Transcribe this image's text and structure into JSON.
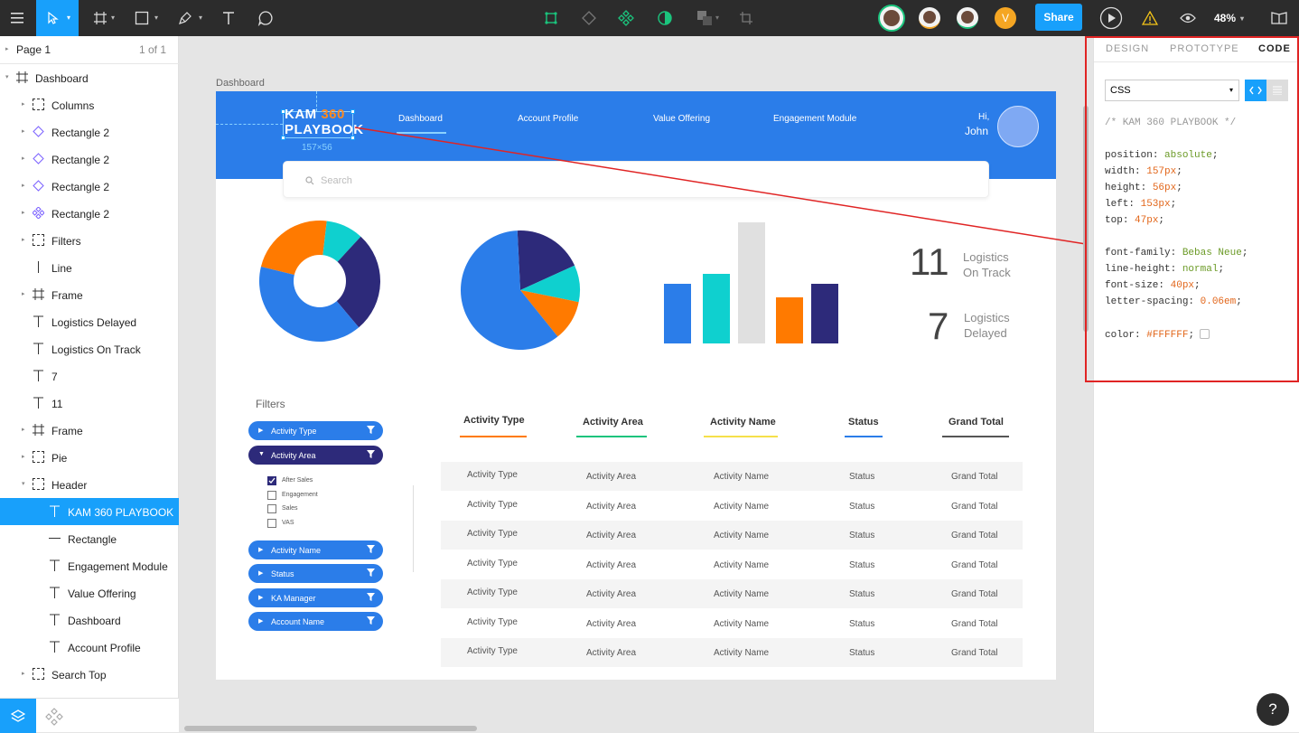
{
  "toolbar": {
    "share_label": "Share",
    "zoom": "48%",
    "avatar_initial": "V"
  },
  "sidebar": {
    "page_name": "Page 1",
    "page_count": "1 of 1",
    "layers": [
      {
        "label": "Dashboard",
        "icon": "frame"
      },
      {
        "label": "Columns",
        "icon": "group"
      },
      {
        "label": "Rectangle 2",
        "icon": "diamond"
      },
      {
        "label": "Rectangle 2",
        "icon": "diamond"
      },
      {
        "label": "Rectangle 2",
        "icon": "diamond"
      },
      {
        "label": "Rectangle 2",
        "icon": "component"
      },
      {
        "label": "Filters",
        "icon": "group"
      },
      {
        "label": "Line",
        "icon": "line"
      },
      {
        "label": "Frame",
        "icon": "frame"
      },
      {
        "label": "Logistics Delayed",
        "icon": "text"
      },
      {
        "label": "Logistics On Track",
        "icon": "text"
      },
      {
        "label": "7",
        "icon": "text"
      },
      {
        "label": "11",
        "icon": "text"
      },
      {
        "label": "Frame",
        "icon": "frame"
      },
      {
        "label": "Pie",
        "icon": "group"
      },
      {
        "label": "Header",
        "icon": "group"
      },
      {
        "label": "KAM 360 PLAYBOOK",
        "icon": "text"
      },
      {
        "label": "Rectangle",
        "icon": "line"
      },
      {
        "label": "Engagement Module",
        "icon": "text"
      },
      {
        "label": "Value Offering",
        "icon": "text"
      },
      {
        "label": "Dashboard",
        "icon": "text"
      },
      {
        "label": "Account Profile",
        "icon": "text"
      },
      {
        "label": "Search Top",
        "icon": "group"
      }
    ]
  },
  "canvas": {
    "frame_label": "Dashboard",
    "logo_kam": "KAM",
    "logo_360": "360",
    "logo_playbook": "PLAYBOOK",
    "size_label": "157×56",
    "nav": [
      "Dashboard",
      "Account Profile",
      "Value Offering",
      "Engagement Module"
    ],
    "greeting": "Hi,",
    "user": "John",
    "search_placeholder": "Search",
    "stats": [
      {
        "value": "11",
        "label_l1": "Logistics",
        "label_l2": "On Track"
      },
      {
        "value": "7",
        "label_l1": "Logistics",
        "label_l2": "Delayed"
      }
    ],
    "filters_title": "Filters",
    "filters": [
      "Activity Type",
      "Activity Area",
      "Activity Name",
      "Status",
      "KA Manager",
      "Account Name"
    ],
    "checkbox_options": [
      {
        "label": "After Sales",
        "checked": true
      },
      {
        "label": "Engagement",
        "checked": false
      },
      {
        "label": "Sales",
        "checked": false
      },
      {
        "label": "VAS",
        "checked": false
      }
    ],
    "table_headers": [
      "Activity Type",
      "Activity Area",
      "Activity Name",
      "Status",
      "Grand Total"
    ],
    "table_rows": [
      [
        "Activity Type",
        "Activity Area",
        "Activity Name",
        "Status",
        "Grand Total"
      ],
      [
        "Activity Type",
        "Activity Area",
        "Activity Name",
        "Status",
        "Grand Total"
      ],
      [
        "Activity Type",
        "Activity Area",
        "Activity Name",
        "Status",
        "Grand Total"
      ],
      [
        "Activity Type",
        "Activity Area",
        "Activity Name",
        "Status",
        "Grand Total"
      ],
      [
        "Activity Type",
        "Activity Area",
        "Activity Name",
        "Status",
        "Grand Total"
      ],
      [
        "Activity Type",
        "Activity Area",
        "Activity Name",
        "Status",
        "Grand Total"
      ],
      [
        "Activity Type",
        "Activity Area",
        "Activity Name",
        "Status",
        "Grand Total"
      ]
    ]
  },
  "colors": {
    "blue": "#2b7de9",
    "orange": "#ff7a00",
    "teal": "#0fd0cf",
    "navy": "#2d2a7a",
    "gray": "#e0e0e0",
    "selection": "#18a0fb"
  },
  "charts": {
    "donut": [
      {
        "color": "#ff7a00",
        "value": 23
      },
      {
        "color": "#0fd0cf",
        "value": 10
      },
      {
        "color": "#2d2a7a",
        "value": 27
      },
      {
        "color": "#2b7de9",
        "value": 40
      }
    ],
    "pie": [
      {
        "color": "#2d2a7a",
        "value": 19
      },
      {
        "color": "#0fd0cf",
        "value": 10
      },
      {
        "color": "#ff7a00",
        "value": 11
      },
      {
        "color": "#2b7de9",
        "value": 60
      }
    ],
    "bars": [
      {
        "color": "#2b7de9",
        "value": 66
      },
      {
        "color": "#0fd0cf",
        "value": 77
      },
      {
        "color": "#e0e0e0",
        "value": 134
      },
      {
        "color": "#ff7a00",
        "value": 51
      },
      {
        "color": "#2d2a7a",
        "value": 66
      }
    ]
  },
  "right_panel": {
    "tabs": [
      "DESIGN",
      "PROTOTYPE",
      "CODE"
    ],
    "language": "CSS",
    "comment": "/* KAM 360 PLAYBOOK */",
    "props": [
      {
        "k": "position",
        "v": "absolute",
        "t": "v"
      },
      {
        "k": "width",
        "v": "157px",
        "t": "n"
      },
      {
        "k": "height",
        "v": "56px",
        "t": "n"
      },
      {
        "k": "left",
        "v": "153px",
        "t": "n"
      },
      {
        "k": "top",
        "v": "47px",
        "t": "n"
      },
      {
        "k": "",
        "v": "",
        "t": ""
      },
      {
        "k": "font-family",
        "v": "Bebas Neue",
        "t": "v"
      },
      {
        "k": "line-height",
        "v": "normal",
        "t": "v"
      },
      {
        "k": "font-size",
        "v": "40px",
        "t": "n"
      },
      {
        "k": "letter-spacing",
        "v": "0.06em",
        "t": "n"
      },
      {
        "k": "",
        "v": "",
        "t": ""
      },
      {
        "k": "color",
        "v": "#FFFFFF",
        "t": "n"
      }
    ]
  },
  "help": "?"
}
